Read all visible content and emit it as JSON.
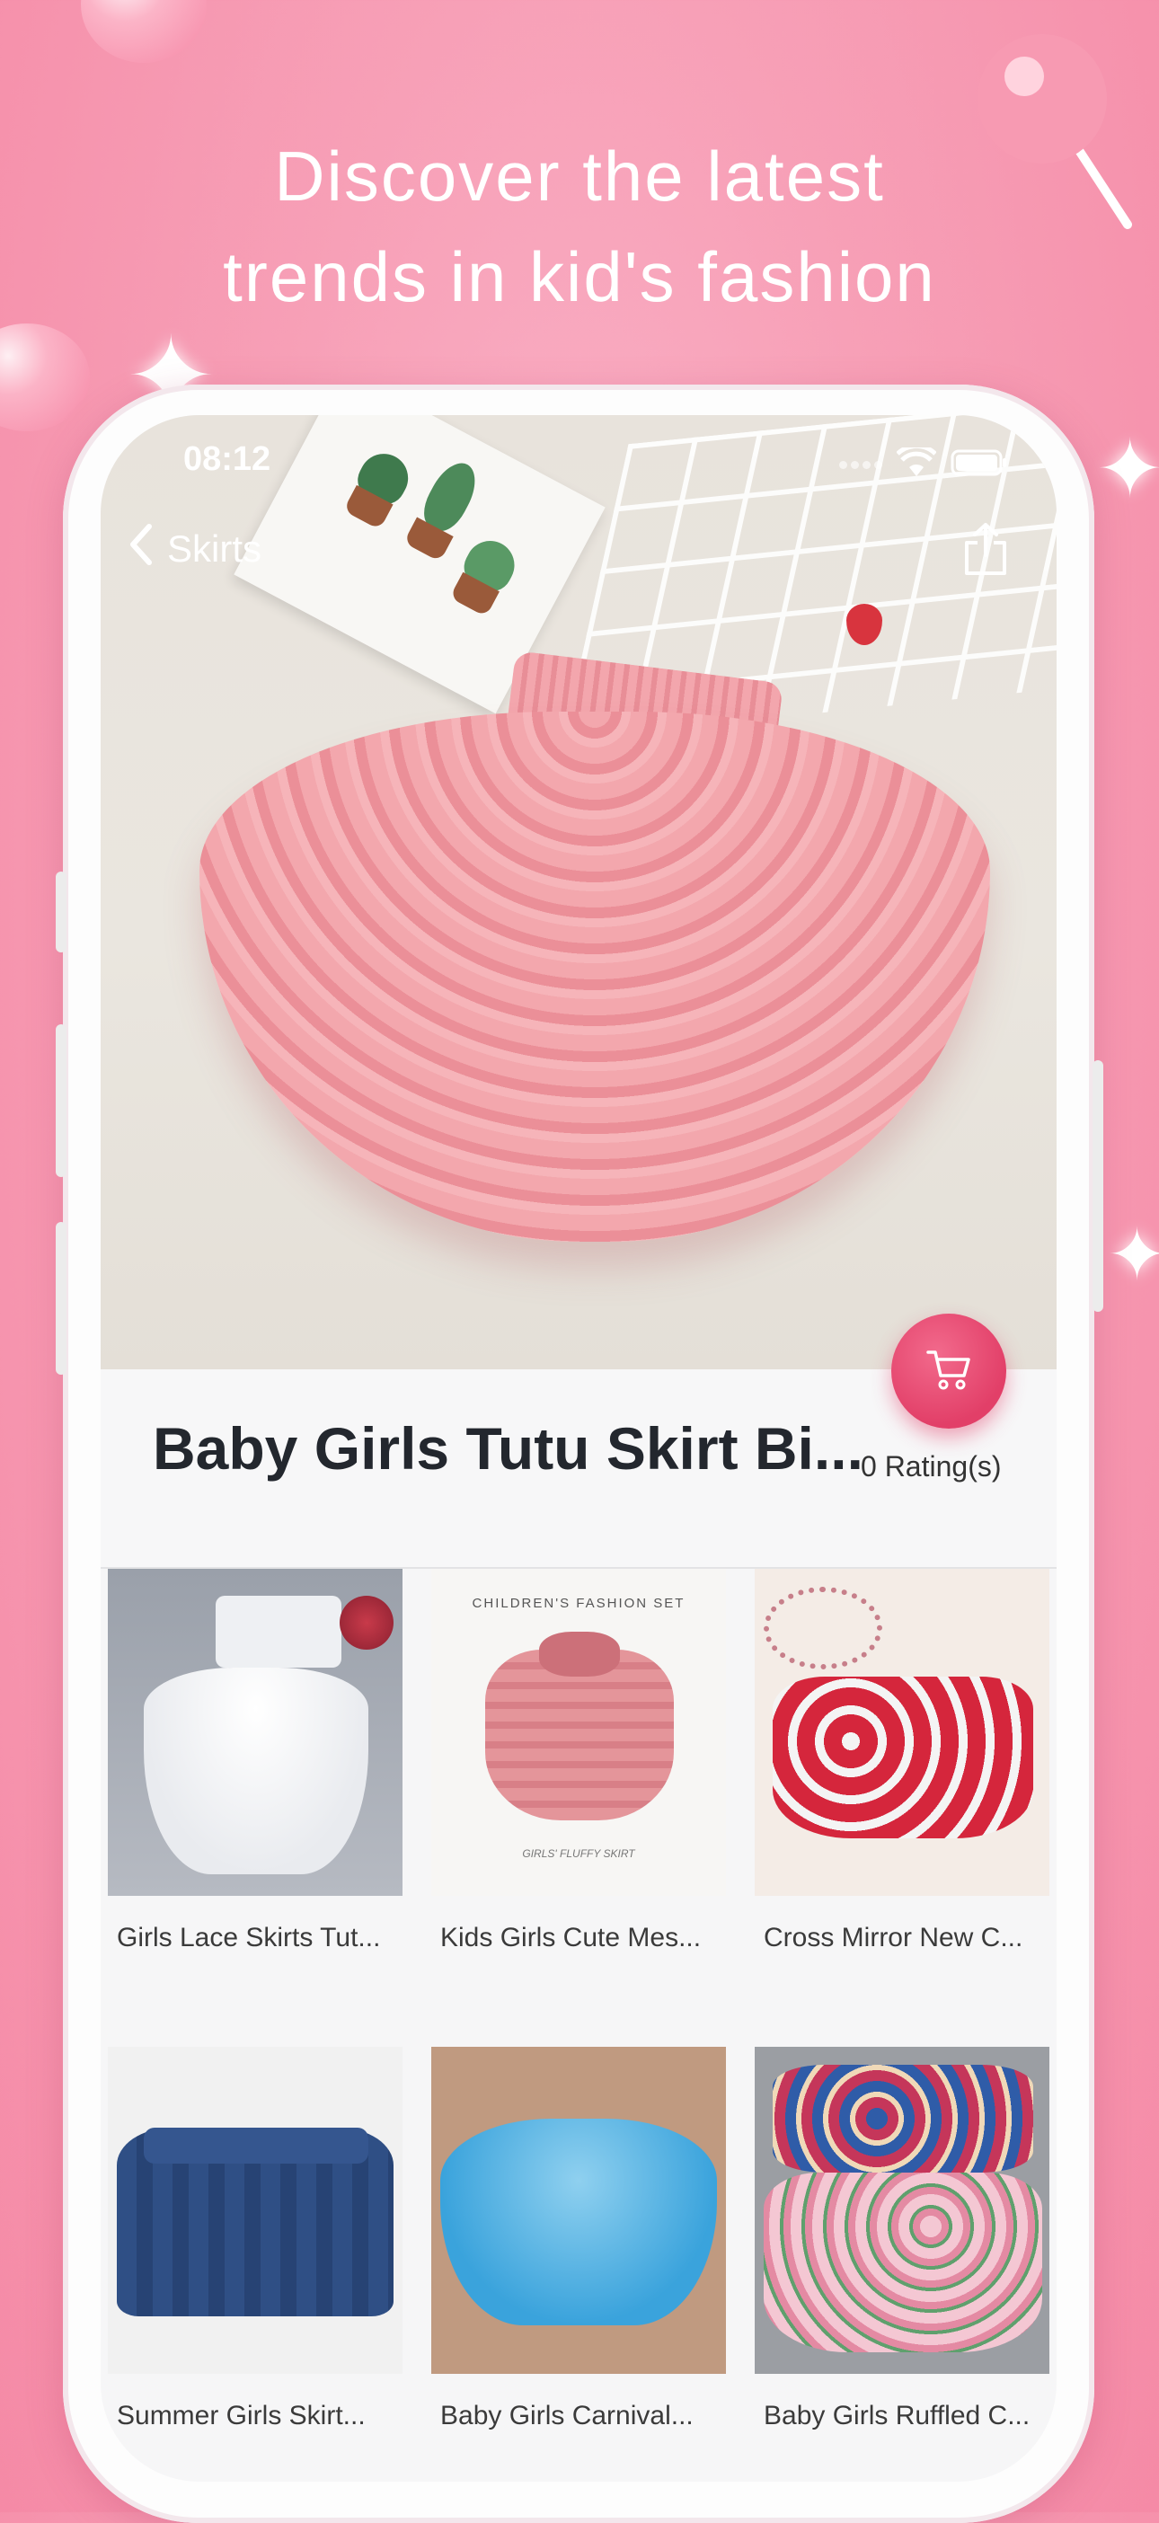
{
  "headline": {
    "line1": "Discover the latest",
    "line2": "trends in kid's fashion"
  },
  "status_bar": {
    "time": "08:12",
    "icons": [
      "signal-dots-icon",
      "wifi-icon",
      "battery-icon"
    ]
  },
  "nav": {
    "back_label": "Skirts",
    "back_icon": "chevron-left-icon",
    "share_icon": "share-icon"
  },
  "product": {
    "title": "Baby Girls Tutu Skirt Bi...",
    "rating": "0 Rating(s)",
    "cart_icon": "cart-icon"
  },
  "related": [
    {
      "caption": "Girls Lace Skirts Tut..."
    },
    {
      "caption": "Kids Girls Cute Mes...",
      "image_text_top": "CHILDREN'S FASHION SET",
      "image_text_bottom": "GIRLS' FLUFFY SKIRT"
    },
    {
      "caption": "Cross Mirror New C..."
    },
    {
      "caption": "Summer Girls Skirt..."
    },
    {
      "caption": "Baby Girls Carnival..."
    },
    {
      "caption": "Baby Girls Ruffled C..."
    }
  ],
  "colors": {
    "accent": "#e23f68",
    "background": "#f7a0b7",
    "title": "#23272e"
  }
}
